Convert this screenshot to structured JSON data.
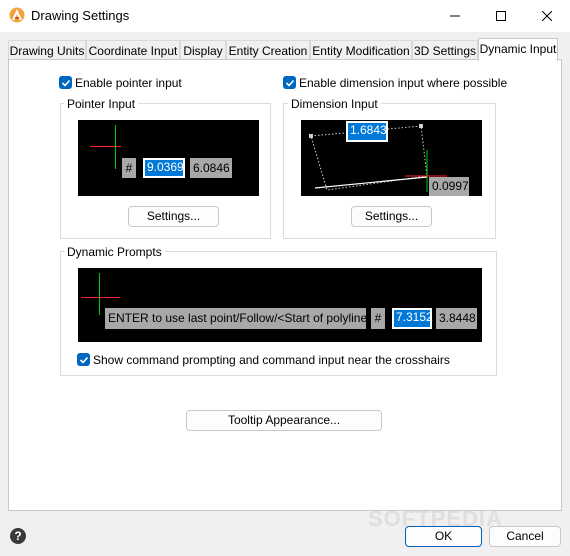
{
  "window": {
    "title": "Drawing Settings"
  },
  "tabs": [
    {
      "label": "Drawing Units"
    },
    {
      "label": "Coordinate Input"
    },
    {
      "label": "Display"
    },
    {
      "label": "Entity Creation"
    },
    {
      "label": "Entity Modification"
    },
    {
      "label": "3D Settings"
    },
    {
      "label": "Dynamic Input"
    }
  ],
  "active_tab": "Dynamic Input",
  "enable_pointer_input": {
    "label": "Enable pointer input",
    "checked": true
  },
  "enable_dimension_input": {
    "label": "Enable dimension input where possible",
    "checked": true
  },
  "pointer_input": {
    "title": "Pointer Input",
    "hash": "#",
    "x_value": "9.0369",
    "y_value": "6.0846",
    "settings_label": "Settings..."
  },
  "dimension_input": {
    "title": "Dimension Input",
    "length_value": "1.6843",
    "angle_value": "0.0997",
    "settings_label": "Settings..."
  },
  "dynamic_prompts": {
    "title": "Dynamic Prompts",
    "prompt_text": "ENTER to use last point/Follow/<Start of polyline>:",
    "hash": "#",
    "x_value": "7.3152",
    "y_value": "3.8448",
    "show_prompting": {
      "label": "Show command prompting and command input near the crosshairs",
      "checked": true
    }
  },
  "tooltip_button": {
    "label": "Tooltip Appearance..."
  },
  "footer": {
    "ok_label": "OK",
    "cancel_label": "Cancel"
  },
  "watermark": "SOFTPEDIA",
  "colors": {
    "accent": "#0067c0",
    "selection": "#0078d7",
    "crosshair_red": "#ff2020",
    "crosshair_green": "#00d000"
  }
}
